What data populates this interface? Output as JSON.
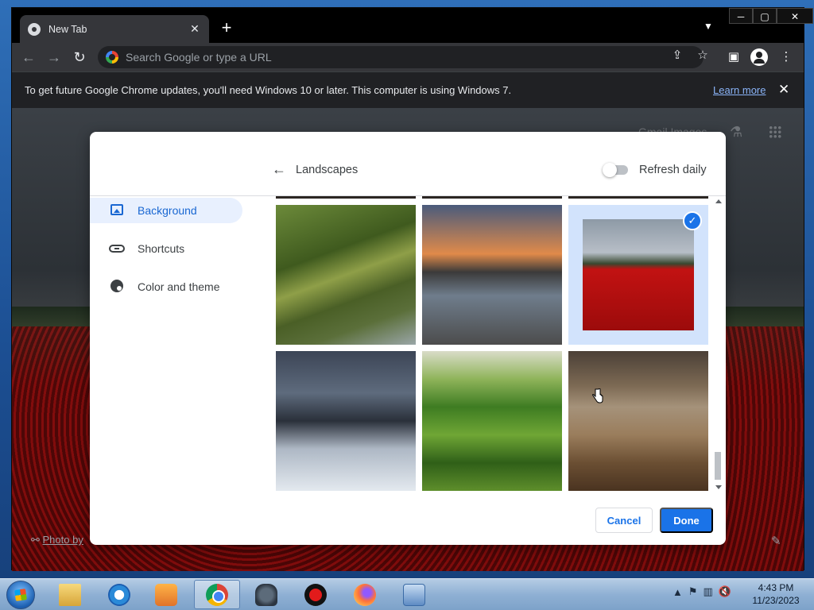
{
  "browser": {
    "tab_title": "New Tab",
    "new_tab": "+",
    "tab_search": "⌄",
    "omnibox_placeholder": "Search Google or type a URL",
    "infobar": {
      "message": "To get future Google Chrome updates, you'll need Windows 10 or later. This computer is using Windows 7.",
      "link": "Learn more"
    }
  },
  "page": {
    "top_links": "Gmail   Images",
    "photo_credit": "Photo by"
  },
  "dialog": {
    "crumb": "Landscapes",
    "refresh_label": "Refresh daily",
    "refresh_on": false,
    "nav": [
      {
        "label": "Background",
        "icon": "image-icon",
        "active": true
      },
      {
        "label": "Shortcuts",
        "icon": "link-icon",
        "active": false
      },
      {
        "label": "Color and theme",
        "icon": "palette-icon",
        "active": false
      }
    ],
    "images": [
      {
        "name": "mountain",
        "selected": false
      },
      {
        "name": "rock-coast",
        "selected": false
      },
      {
        "name": "tulip-field",
        "selected": true
      },
      {
        "name": "waterfall",
        "selected": false
      },
      {
        "name": "tea-terraces",
        "selected": false
      },
      {
        "name": "beach",
        "selected": false
      }
    ],
    "cancel_label": "Cancel",
    "done_label": "Done"
  },
  "taskbar": {
    "apps": [
      "Windows Explorer",
      "Internet Explorer",
      "Windows Media Player",
      "Google Chrome",
      "GIMP",
      "Screen Recorder",
      "Firefox",
      "Control Panel"
    ],
    "active_app": "Google Chrome",
    "time": "4:43 PM",
    "date": "11/23/2023"
  },
  "colors": {
    "accent": "#1a73e8",
    "active_nav_bg": "#e8f0fe",
    "chrome_frame": "#202124"
  }
}
